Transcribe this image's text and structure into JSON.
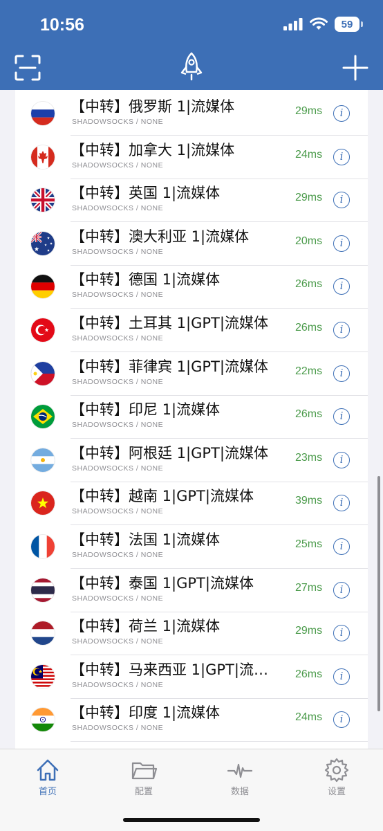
{
  "status_bar": {
    "time": "10:56",
    "battery": "59",
    "icons": [
      "signal-icon",
      "wifi-icon",
      "battery-icon"
    ]
  },
  "header": {
    "left_icon": "scan-icon",
    "center_icon": "rocket-icon",
    "right_icon": "plus-icon"
  },
  "colors": {
    "brand": "#3d6fb6",
    "latency": "#4a9a4a",
    "separator": "#e1e1e6"
  },
  "servers": [
    {
      "flag": "russia-flag",
      "name": "【中转】俄罗斯 1|流媒体",
      "protocol": "SHADOWSOCKS / NONE",
      "latency": "29ms"
    },
    {
      "flag": "canada-flag",
      "name": "【中转】加拿大 1|流媒体",
      "protocol": "SHADOWSOCKS / NONE",
      "latency": "24ms"
    },
    {
      "flag": "uk-flag",
      "name": "【中转】英国 1|流媒体",
      "protocol": "SHADOWSOCKS / NONE",
      "latency": "29ms"
    },
    {
      "flag": "australia-flag",
      "name": "【中转】澳大利亚 1|流媒体",
      "protocol": "SHADOWSOCKS / NONE",
      "latency": "20ms"
    },
    {
      "flag": "germany-flag",
      "name": "【中转】德国 1|流媒体",
      "protocol": "SHADOWSOCKS / NONE",
      "latency": "26ms"
    },
    {
      "flag": "turkey-flag",
      "name": "【中转】土耳其 1|GPT|流媒体",
      "protocol": "SHADOWSOCKS / NONE",
      "latency": "26ms"
    },
    {
      "flag": "philippines-flag",
      "name": "【中转】菲律宾 1|GPT|流媒体",
      "protocol": "SHADOWSOCKS / NONE",
      "latency": "22ms"
    },
    {
      "flag": "brazil-flag",
      "name": "【中转】印尼 1|流媒体",
      "protocol": "SHADOWSOCKS / NONE",
      "latency": "26ms"
    },
    {
      "flag": "argentina-flag",
      "name": "【中转】阿根廷 1|GPT|流媒体",
      "protocol": "SHADOWSOCKS / NONE",
      "latency": "23ms"
    },
    {
      "flag": "vietnam-flag",
      "name": "【中转】越南 1|GPT|流媒体",
      "protocol": "SHADOWSOCKS / NONE",
      "latency": "39ms"
    },
    {
      "flag": "france-flag",
      "name": "【中转】法国 1|流媒体",
      "protocol": "SHADOWSOCKS / NONE",
      "latency": "25ms"
    },
    {
      "flag": "thailand-flag",
      "name": "【中转】泰国 1|GPT|流媒体",
      "protocol": "SHADOWSOCKS / NONE",
      "latency": "27ms"
    },
    {
      "flag": "netherlands-flag",
      "name": "【中转】荷兰 1|流媒体",
      "protocol": "SHADOWSOCKS / NONE",
      "latency": "29ms"
    },
    {
      "flag": "malaysia-flag",
      "name": "【中转】马来西亚 1|GPT|流…",
      "protocol": "SHADOWSOCKS / NONE",
      "latency": "26ms"
    },
    {
      "flag": "india-flag",
      "name": "【中转】印度 1|流媒体",
      "protocol": "SHADOWSOCKS / NONE",
      "latency": "24ms"
    }
  ],
  "tabs": [
    {
      "label": "首页",
      "icon": "home-icon",
      "active": true
    },
    {
      "label": "配置",
      "icon": "folder-icon",
      "active": false
    },
    {
      "label": "数据",
      "icon": "activity-icon",
      "active": false
    },
    {
      "label": "设置",
      "icon": "gear-icon",
      "active": false
    }
  ]
}
